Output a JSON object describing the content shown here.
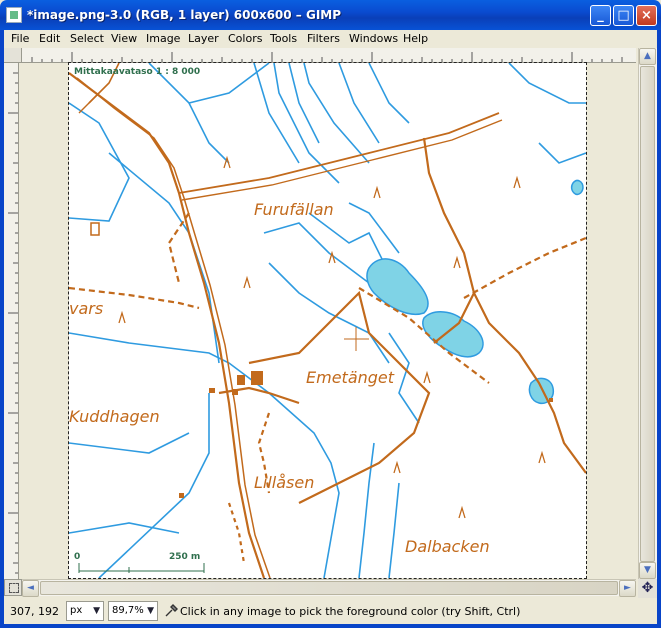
{
  "window": {
    "title": "*image.png-3.0 (RGB, 1 layer) 600x600 – GIMP",
    "minimize_glyph": "_",
    "maximize_glyph": "□",
    "close_glyph": "×"
  },
  "menubar": {
    "items": [
      "File",
      "Edit",
      "Select",
      "View",
      "Image",
      "Layer",
      "Colors",
      "Tools",
      "Filters",
      "Windows",
      "Help"
    ]
  },
  "map": {
    "scale_title": "Mittakaavataso 1 : 8 000",
    "scale_start": "0",
    "scale_end": "250 m",
    "place_names": [
      "Furufällan",
      "vars",
      "Emetänget",
      "Kuddhagen",
      "Lillåsen",
      "Dalbacken"
    ]
  },
  "statusbar": {
    "coordinates": "307, 192",
    "unit": "px",
    "zoom": "89,7%",
    "message": "Click in any image to pick the foreground color (try Shift, Ctrl)"
  },
  "icons": {
    "navigate": "✥",
    "scroll_up": "▲",
    "scroll_down": "▼",
    "scroll_left": "◄",
    "scroll_right": "►",
    "dropdown": "▼"
  },
  "colors": {
    "titlebar": "#0a4bd0",
    "map_road": "#c26a1c",
    "map_water": "#2f9be0",
    "map_lake": "#7fd3e6"
  }
}
